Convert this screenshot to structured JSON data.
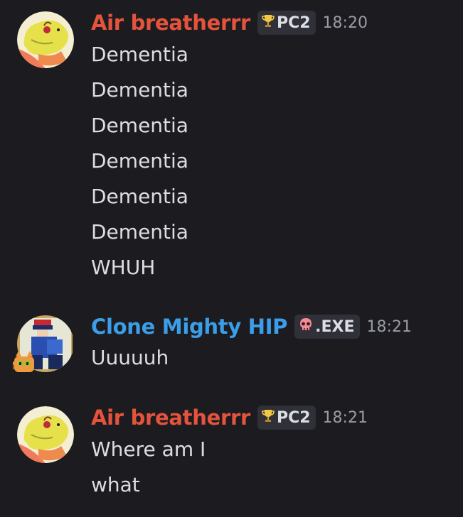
{
  "colors": {
    "background": "#1c1c20",
    "username_red": "#e5533d",
    "username_blue": "#3b9ee8",
    "tag_bg": "#2f3038",
    "timestamp": "#9a9ca6",
    "message_text": "#dcdde2"
  },
  "messages": [
    {
      "author": "Air breatherrr",
      "author_color": "#e5533d",
      "tag_icon": "trophy-icon",
      "tag_label": "PC2",
      "time": "18:20",
      "lines": [
        "Dementia",
        "Dementia",
        "Dementia",
        "Dementia",
        "Dementia",
        "Dementia",
        "WHUH"
      ]
    },
    {
      "author": "Clone Mighty HIP",
      "author_color": "#3b9ee8",
      "tag_icon": "skull-icon",
      "tag_label": ".EXE",
      "time": "18:21",
      "lines": [
        "Uuuuuh"
      ]
    },
    {
      "author": "Air breatherrr",
      "author_color": "#e5533d",
      "tag_icon": "trophy-icon",
      "tag_label": "PC2",
      "time": "18:21",
      "lines": [
        "Where am I",
        "what"
      ]
    }
  ]
}
